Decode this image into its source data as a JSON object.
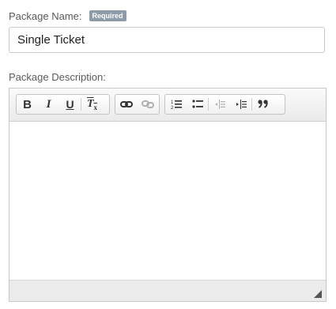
{
  "form": {
    "package_name_label": "Package Name:",
    "required_badge": "Required",
    "package_name_value": "Single Ticket",
    "package_description_label": "Package Description:",
    "package_description_value": ""
  },
  "toolbar": {
    "groups": [
      {
        "name": "basic-styles",
        "buttons": [
          "Bold",
          "Italic",
          "Underline",
          "Remove Format"
        ]
      },
      {
        "name": "links",
        "buttons": [
          "Link",
          "Unlink"
        ]
      },
      {
        "name": "paragraph",
        "buttons": [
          "Numbered List",
          "Bulleted List",
          "Decrease Indent",
          "Increase Indent",
          "Block Quote"
        ]
      }
    ],
    "icons": {
      "bold": "bold-icon",
      "italic": "italic-icon",
      "underline": "underline-icon",
      "remove_format": "clear-formatting-icon",
      "link": "link-icon",
      "unlink": "unlink-icon",
      "numbered_list": "numbered-list-icon",
      "bulleted_list": "bulleted-list-icon",
      "outdent": "outdent-icon",
      "indent": "indent-icon",
      "blockquote": "blockquote-icon"
    },
    "glyphs": {
      "bold": "B",
      "italic": "I",
      "underline": "U",
      "remove_format": "T",
      "remove_format_sub": "x"
    }
  },
  "colors": {
    "badge_bg": "#8d9aa8",
    "border": "#c9c9c9",
    "toolbar_bg": "#eaeaea",
    "disabled_icon": "#b0b0b0"
  }
}
